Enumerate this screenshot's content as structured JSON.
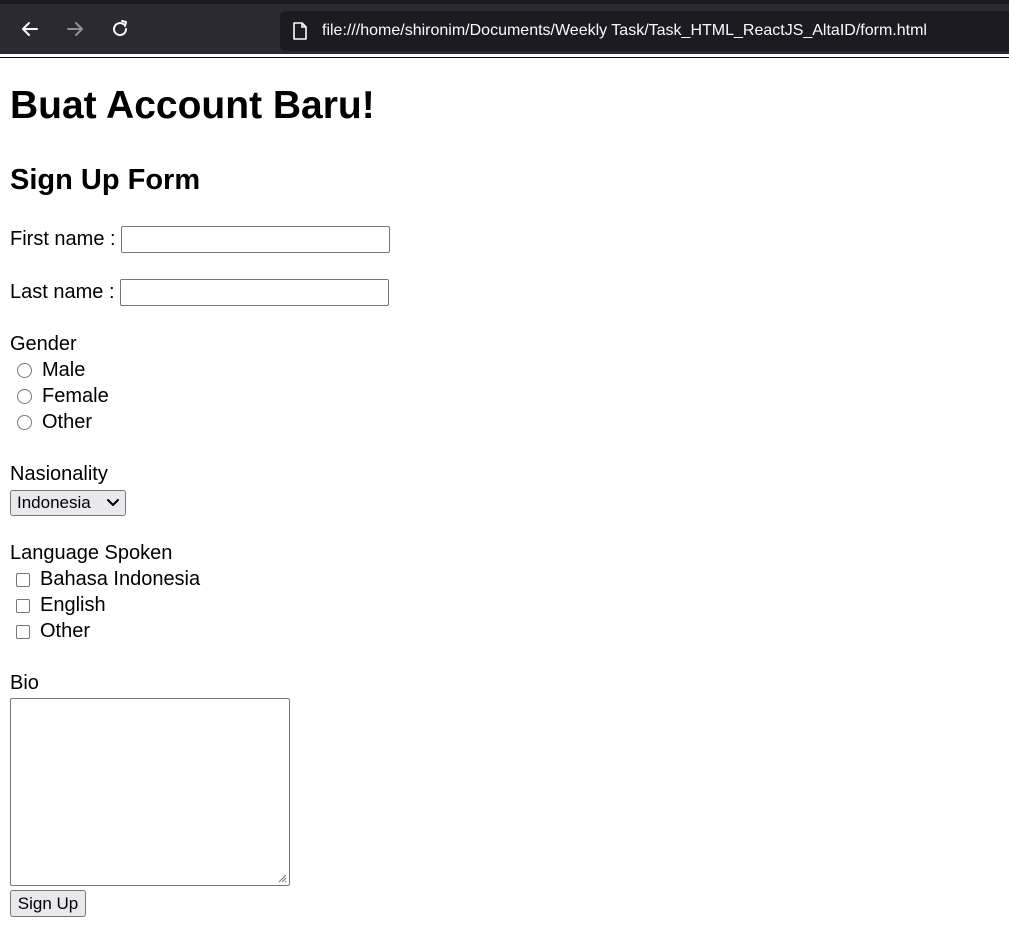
{
  "browser": {
    "url": "file:///home/shironim/Documents/Weekly Task/Task_HTML_ReactJS_AltaID/form.html",
    "icons": [
      "back-arrow-icon",
      "forward-arrow-icon",
      "reload-icon",
      "page-document-icon"
    ]
  },
  "page": {
    "heading": "Buat Account Baru!",
    "subheading": "Sign Up Form"
  },
  "form": {
    "first_name_label": "First name :",
    "first_name_value": "",
    "last_name_label": "Last name :",
    "last_name_value": "",
    "gender": {
      "label": "Gender",
      "options": [
        "Male",
        "Female",
        "Other"
      ]
    },
    "nationality": {
      "label": "Nasionality",
      "selected": "Indonesia"
    },
    "languages": {
      "label": "Language Spoken",
      "options": [
        "Bahasa Indonesia",
        "English",
        "Other"
      ]
    },
    "bio": {
      "label": "Bio",
      "value": ""
    },
    "submit_label": "Sign Up"
  }
}
